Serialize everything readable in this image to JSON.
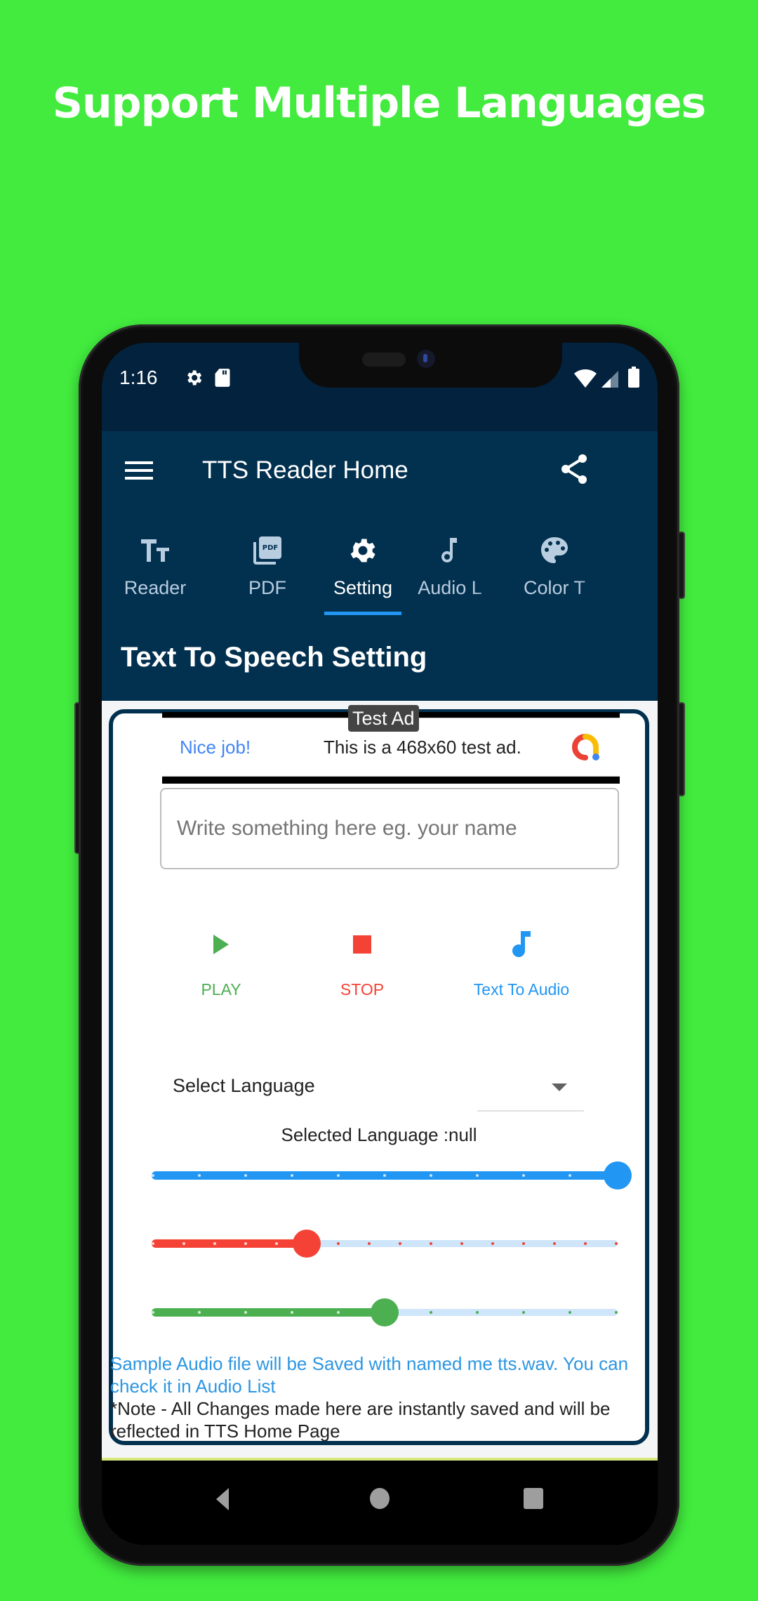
{
  "promo": {
    "headline": "Support Multiple Languages"
  },
  "status_bar": {
    "time": "1:16",
    "left_icons": [
      "gear-icon",
      "sd-card-icon"
    ],
    "right_icons": [
      "wifi-icon",
      "signal-icon",
      "battery-icon"
    ]
  },
  "app_bar": {
    "title": "TTS Reader Home",
    "menu_icon": "hamburger-menu-icon",
    "share_icon": "share-icon"
  },
  "tabs": [
    {
      "label": "Reader",
      "icon": "text-size-icon",
      "active": false
    },
    {
      "label": "PDF",
      "icon": "pdf-icon",
      "active": false
    },
    {
      "label": "Setting",
      "icon": "gear-icon",
      "active": true
    },
    {
      "label": "Audio L",
      "icon": "music-note-icon",
      "active": false
    },
    {
      "label": "Color T",
      "icon": "palette-icon",
      "active": false
    }
  ],
  "section": {
    "title": "Text To Speech Setting"
  },
  "ad": {
    "badge": "Test Ad",
    "headline": "Nice job!",
    "text": "This is a 468x60 test ad."
  },
  "input": {
    "placeholder": "Write something here eg. your name",
    "value": ""
  },
  "actions": [
    {
      "label": "PLAY",
      "icon": "play-icon",
      "color": "#4CAF50"
    },
    {
      "label": "STOP",
      "icon": "stop-icon",
      "color": "#F44336"
    },
    {
      "label": "Text To Audio",
      "icon": "music-note-icon",
      "color": "#2196F3"
    }
  ],
  "language": {
    "dropdown_label": "Select Language",
    "selected_text": "Selected Language :null"
  },
  "sliders": [
    {
      "name": "volume-slider",
      "value": 1.0,
      "color": "#2196F3",
      "ticks": 11
    },
    {
      "name": "pitch-slider",
      "value": 0.333,
      "color": "#F44336",
      "ticks": 16
    },
    {
      "name": "speed-slider",
      "value": 0.5,
      "color": "#4CAF50",
      "ticks": 11
    }
  ],
  "notes": {
    "audio_note": "Sample Audio file will be Saved with named me tts.wav. You can check it in Audio List",
    "save_note": "*Note - All Changes made here are instantly saved and will be reflected in TTS Home Page"
  },
  "nav_bar": {
    "buttons": [
      "back-icon",
      "home-icon",
      "recents-icon"
    ]
  },
  "colors": {
    "background": "#42EB3E",
    "primary_dark": "#03223D",
    "primary": "#02304F",
    "accent": "#2196F3"
  }
}
